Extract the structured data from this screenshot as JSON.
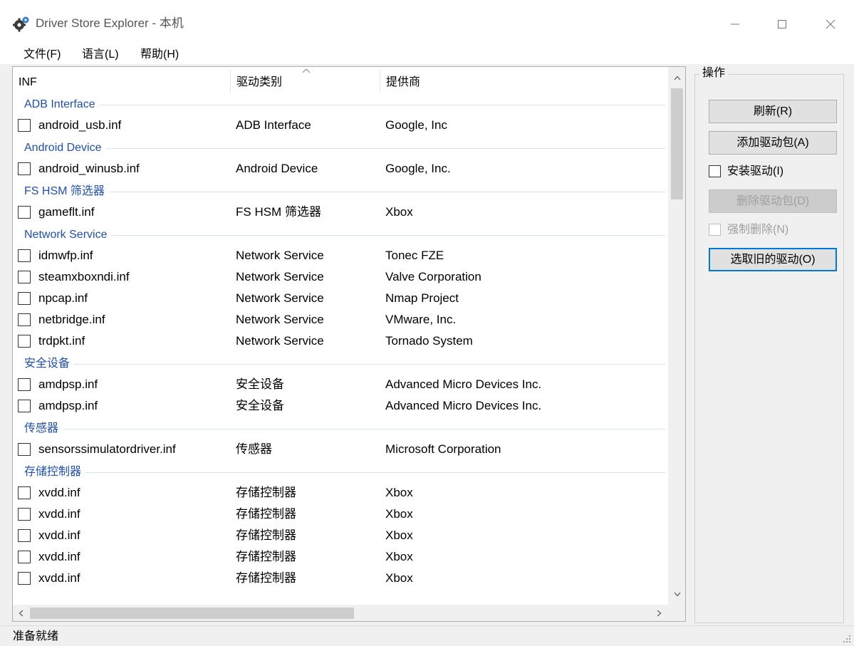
{
  "window": {
    "title": "Driver Store Explorer - 本机",
    "icon": "gear-cog-icon"
  },
  "menu": [
    "文件(F)",
    "语言(L)",
    "帮助(H)"
  ],
  "table": {
    "columns": [
      "INF",
      "驱动类别",
      "提供商"
    ],
    "sorted_column": "驱动类别",
    "groups": [
      {
        "label": "ADB Interface",
        "rows": [
          {
            "inf": "android_usb.inf",
            "type": "ADB Interface",
            "provider": "Google, Inc"
          }
        ]
      },
      {
        "label": "Android Device",
        "rows": [
          {
            "inf": "android_winusb.inf",
            "type": "Android Device",
            "provider": "Google, Inc."
          }
        ]
      },
      {
        "label": "FS HSM 筛选器",
        "rows": [
          {
            "inf": "gameflt.inf",
            "type": "FS HSM 筛选器",
            "provider": "Xbox"
          }
        ]
      },
      {
        "label": "Network Service",
        "rows": [
          {
            "inf": "idmwfp.inf",
            "type": "Network Service",
            "provider": "Tonec FZE"
          },
          {
            "inf": "steamxboxndi.inf",
            "type": "Network Service",
            "provider": "Valve Corporation"
          },
          {
            "inf": "npcap.inf",
            "type": "Network Service",
            "provider": "Nmap Project"
          },
          {
            "inf": "netbridge.inf",
            "type": "Network Service",
            "provider": "VMware, Inc."
          },
          {
            "inf": "trdpkt.inf",
            "type": "Network Service",
            "provider": "Tornado System"
          }
        ]
      },
      {
        "label": "安全设备",
        "rows": [
          {
            "inf": "amdpsp.inf",
            "type": "安全设备",
            "provider": "Advanced Micro Devices Inc."
          },
          {
            "inf": "amdpsp.inf",
            "type": "安全设备",
            "provider": "Advanced Micro Devices Inc."
          }
        ]
      },
      {
        "label": "传感器",
        "rows": [
          {
            "inf": "sensorssimulatordriver.inf",
            "type": "传感器",
            "provider": "Microsoft Corporation"
          }
        ]
      },
      {
        "label": "存储控制器",
        "rows": [
          {
            "inf": "xvdd.inf",
            "type": "存储控制器",
            "provider": "Xbox"
          },
          {
            "inf": "xvdd.inf",
            "type": "存储控制器",
            "provider": "Xbox"
          },
          {
            "inf": "xvdd.inf",
            "type": "存储控制器",
            "provider": "Xbox"
          },
          {
            "inf": "xvdd.inf",
            "type": "存储控制器",
            "provider": "Xbox"
          },
          {
            "inf": "xvdd.inf",
            "type": "存储控制器",
            "provider": "Xbox"
          }
        ]
      }
    ]
  },
  "operations": {
    "title": "操作",
    "refresh": "刷新(R)",
    "add_package": "添加驱动包(A)",
    "install_driver": "安装驱动(I)",
    "delete_package": "删除驱动包(D)",
    "force_delete": "强制删除(N)",
    "select_old": "选取旧的驱动(O)"
  },
  "status": "准备就绪",
  "colors": {
    "group_text": "#1f4fb0",
    "focus_border": "#0078d7"
  }
}
